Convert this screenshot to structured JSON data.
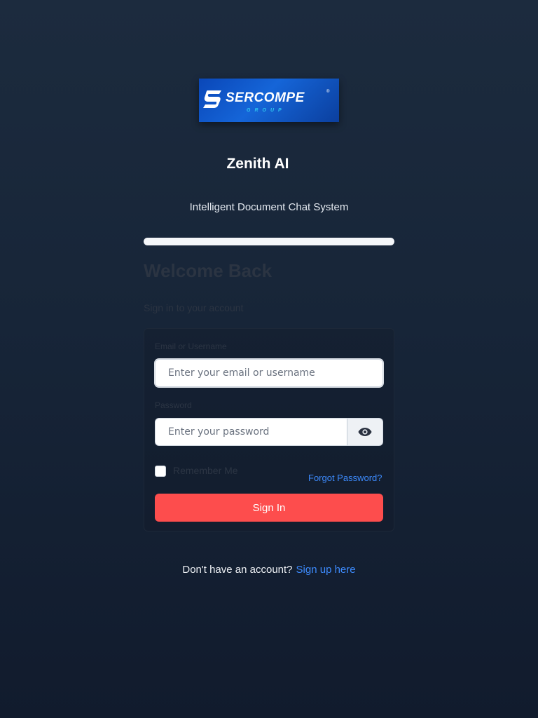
{
  "brand": {
    "logo_name": "SERCOMPE",
    "logo_reg": "®",
    "logo_sub": "GROUP",
    "logo_color": "#0a47b8"
  },
  "app": {
    "title": "Zenith AI",
    "subtitle": "Intelligent Document Chat System"
  },
  "progress": {
    "fraction": 1.0
  },
  "login": {
    "heading": "Welcome Back",
    "subheading": "Sign in to your account",
    "email_label": "Email or Username",
    "email_placeholder": "Enter your email or username",
    "email_value": "",
    "password_label": "Password",
    "password_placeholder": "Enter your password",
    "password_value": "",
    "toggle_icon": "eye-icon",
    "remember_label": "Remember Me",
    "remember_checked": false,
    "forgot_label": "Forgot Password?",
    "submit_label": "Sign In"
  },
  "footer": {
    "prompt": "Don't have an account?",
    "link_label": "Sign up here"
  },
  "colors": {
    "accent_button": "#fd4d4d",
    "link": "#3d8bfd",
    "background_top": "#1c2b3e",
    "background_bottom": "#111b2d"
  }
}
